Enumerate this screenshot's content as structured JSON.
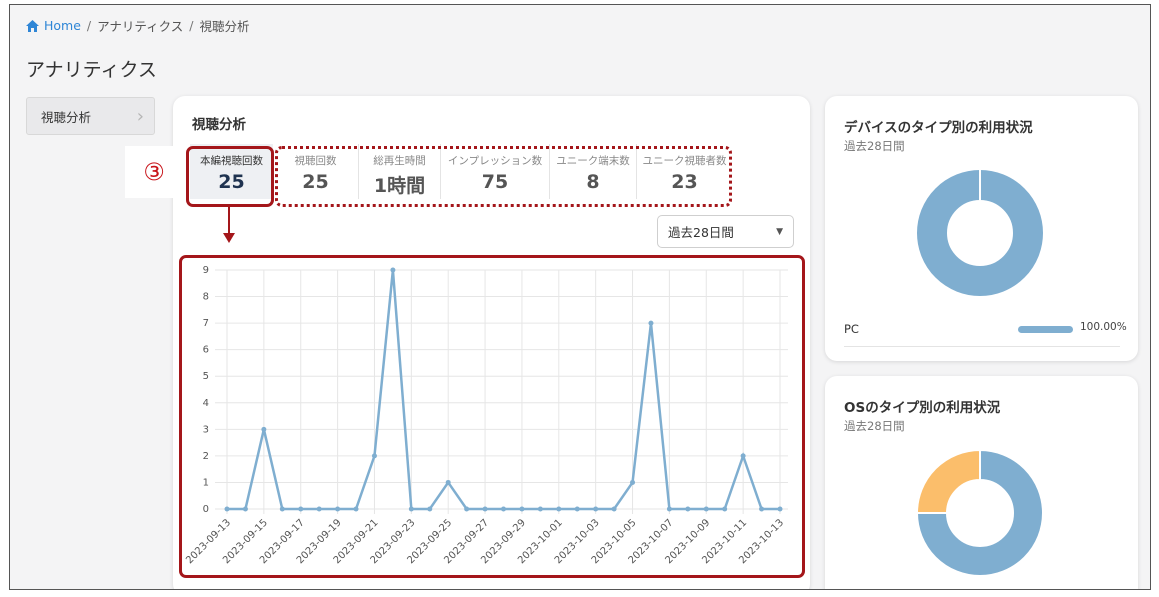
{
  "breadcrumb": {
    "home": "Home",
    "sep1": "/",
    "section": "アナリティクス",
    "sep2": "/",
    "current": "視聴分析"
  },
  "page_title": "アナリティクス",
  "subnav": {
    "label": "視聴分析"
  },
  "main": {
    "title": "視聴分析",
    "metrics": [
      {
        "label": "本編視聴回数",
        "value": "25"
      },
      {
        "label": "視聴回数",
        "value": "25"
      },
      {
        "label": "総再生時間",
        "value": "1時間"
      },
      {
        "label": "インプレッション数",
        "value": "75"
      },
      {
        "label": "ユニーク端末数",
        "value": "8"
      },
      {
        "label": "ユニーク視聴者数",
        "value": "23"
      }
    ],
    "period_select": {
      "selected": "過去28日間"
    }
  },
  "annotation": {
    "step": "③",
    "color": "#a4161a"
  },
  "chart_data": {
    "type": "line",
    "x": [
      "2023-09-13",
      "2023-09-14",
      "2023-09-15",
      "2023-09-16",
      "2023-09-17",
      "2023-09-18",
      "2023-09-19",
      "2023-09-20",
      "2023-09-21",
      "2023-09-22",
      "2023-09-23",
      "2023-09-24",
      "2023-09-25",
      "2023-09-26",
      "2023-09-27",
      "2023-09-28",
      "2023-09-29",
      "2023-09-30",
      "2023-10-01",
      "2023-10-02",
      "2023-10-03",
      "2023-10-04",
      "2023-10-05",
      "2023-10-06",
      "2023-10-07",
      "2023-10-08",
      "2023-10-09",
      "2023-10-10",
      "2023-10-11",
      "2023-10-12",
      "2023-10-13"
    ],
    "series": [
      {
        "values": [
          0,
          0,
          3,
          0,
          0,
          0,
          0,
          0,
          2,
          9,
          0,
          0,
          1,
          0,
          0,
          0,
          0,
          0,
          0,
          0,
          0,
          0,
          1,
          7,
          0,
          0,
          0,
          0,
          2,
          0,
          0
        ]
      }
    ],
    "x_tick_labels": [
      "2023-09-13",
      "2023-09-15",
      "2023-09-17",
      "2023-09-19",
      "2023-09-21",
      "2023-09-23",
      "2023-09-25",
      "2023-09-27",
      "2023-09-29",
      "2023-10-01",
      "2023-10-03",
      "2023-10-05",
      "2023-10-07",
      "2023-10-09",
      "2023-10-11",
      "2023-10-13"
    ],
    "y_ticks": [
      "0",
      "1",
      "2",
      "3",
      "4",
      "5",
      "6",
      "7",
      "8",
      "9"
    ],
    "ylim": [
      0,
      9
    ],
    "grid": true,
    "line_color": "#7faed0"
  },
  "device_card": {
    "title": "デバイスのタイプ別の利用状況",
    "subtitle": "過去28日間",
    "legend": [
      {
        "label": "PC",
        "percent": "100.00%"
      }
    ],
    "donut": [
      {
        "label": "PC",
        "value": 100,
        "color": "#7faed0"
      }
    ]
  },
  "os_card": {
    "title": "OSのタイプ別の利用状況",
    "subtitle": "過去28日間",
    "donut": [
      {
        "value": 75,
        "color": "#7faed0"
      },
      {
        "value": 25,
        "color": "#fbbe6b"
      }
    ]
  }
}
